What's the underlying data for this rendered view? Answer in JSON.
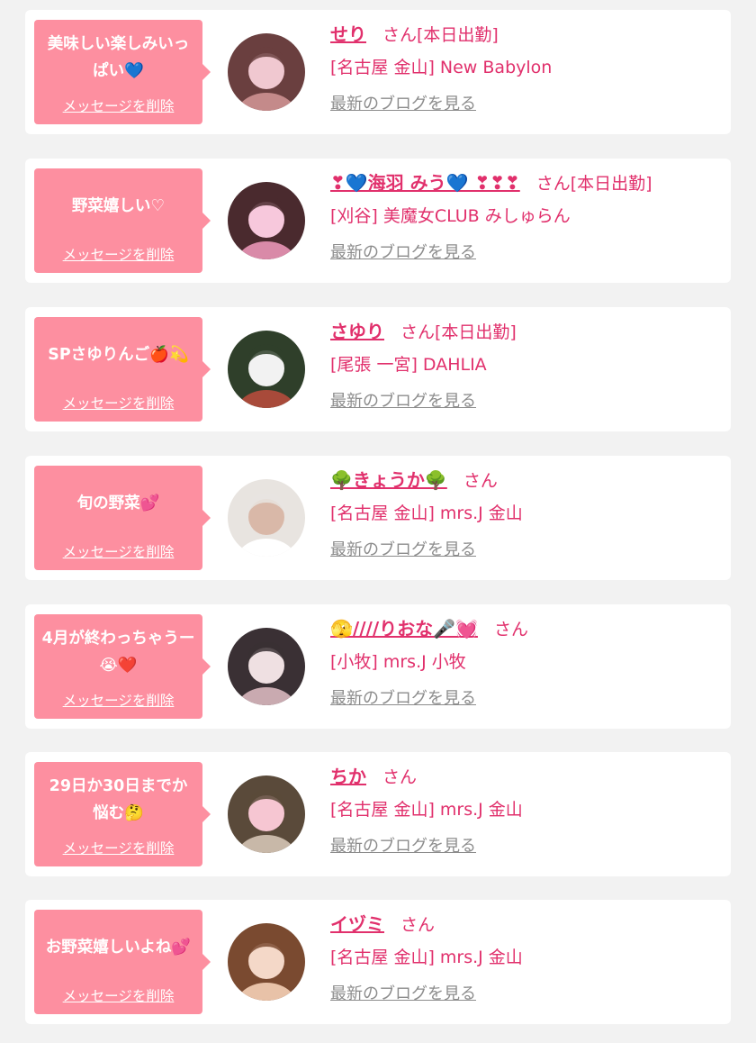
{
  "common": {
    "delete_label": "メッセージを削除",
    "blog_label": "最新のブログを見る",
    "accent_color": "#e1306c",
    "bubble_color": "#fd8fa0",
    "link_gray": "#8c8c8c"
  },
  "entries": [
    {
      "message": "美味しい楽しみいっぱい💙",
      "name": "せり",
      "suffix": "さん[本日出勤]",
      "shop": "[名古屋 金山] New Babylon",
      "avatar_palette": [
        "#6a3f3f",
        "#c48a8a",
        "#f0c8d0"
      ]
    },
    {
      "message": "野菜嬉しい♡",
      "name": "❣💙海羽 みう💙 ❣❣❣",
      "suffix": "さん[本日出勤]",
      "shop": "[刈谷] 美魔女CLUB みしゅらん",
      "avatar_palette": [
        "#4a2a2e",
        "#d98aa8",
        "#f7c8dc"
      ]
    },
    {
      "message": "SPさゆりんご🍎💫",
      "name": "さゆり",
      "suffix": "さん[本日出勤]",
      "shop": "[尾張 一宮] DAHLIA",
      "avatar_palette": [
        "#2f3f2a",
        "#a84a3a",
        "#f2f2f2"
      ]
    },
    {
      "message": "旬の野菜💕",
      "name": "🌳きょうか🌳",
      "suffix": "さん",
      "shop": "[名古屋 金山] mrs.J 金山",
      "avatar_palette": [
        "#e8e4e0",
        "#ffffff",
        "#d9b8a8"
      ]
    },
    {
      "message": "4月が終わっちゃうー😭❤️",
      "name": "🫣////りおな🎤💓",
      "suffix": "さん",
      "shop": "[小牧] mrs.J 小牧",
      "avatar_palette": [
        "#3a3034",
        "#c9aab0",
        "#efe0e2"
      ]
    },
    {
      "message": "29日か30日までか悩む🤔",
      "name": "ちか",
      "suffix": "さん",
      "shop": "[名古屋 金山] mrs.J 金山",
      "avatar_palette": [
        "#5a4a3a",
        "#c8b8a8",
        "#f6c6d2"
      ]
    },
    {
      "message": "お野菜嬉しいよね💕",
      "name": "イヅミ",
      "suffix": "さん",
      "shop": "[名古屋 金山] mrs.J 金山",
      "avatar_palette": [
        "#7a4a30",
        "#e8c2a8",
        "#f4d8c8"
      ]
    }
  ]
}
